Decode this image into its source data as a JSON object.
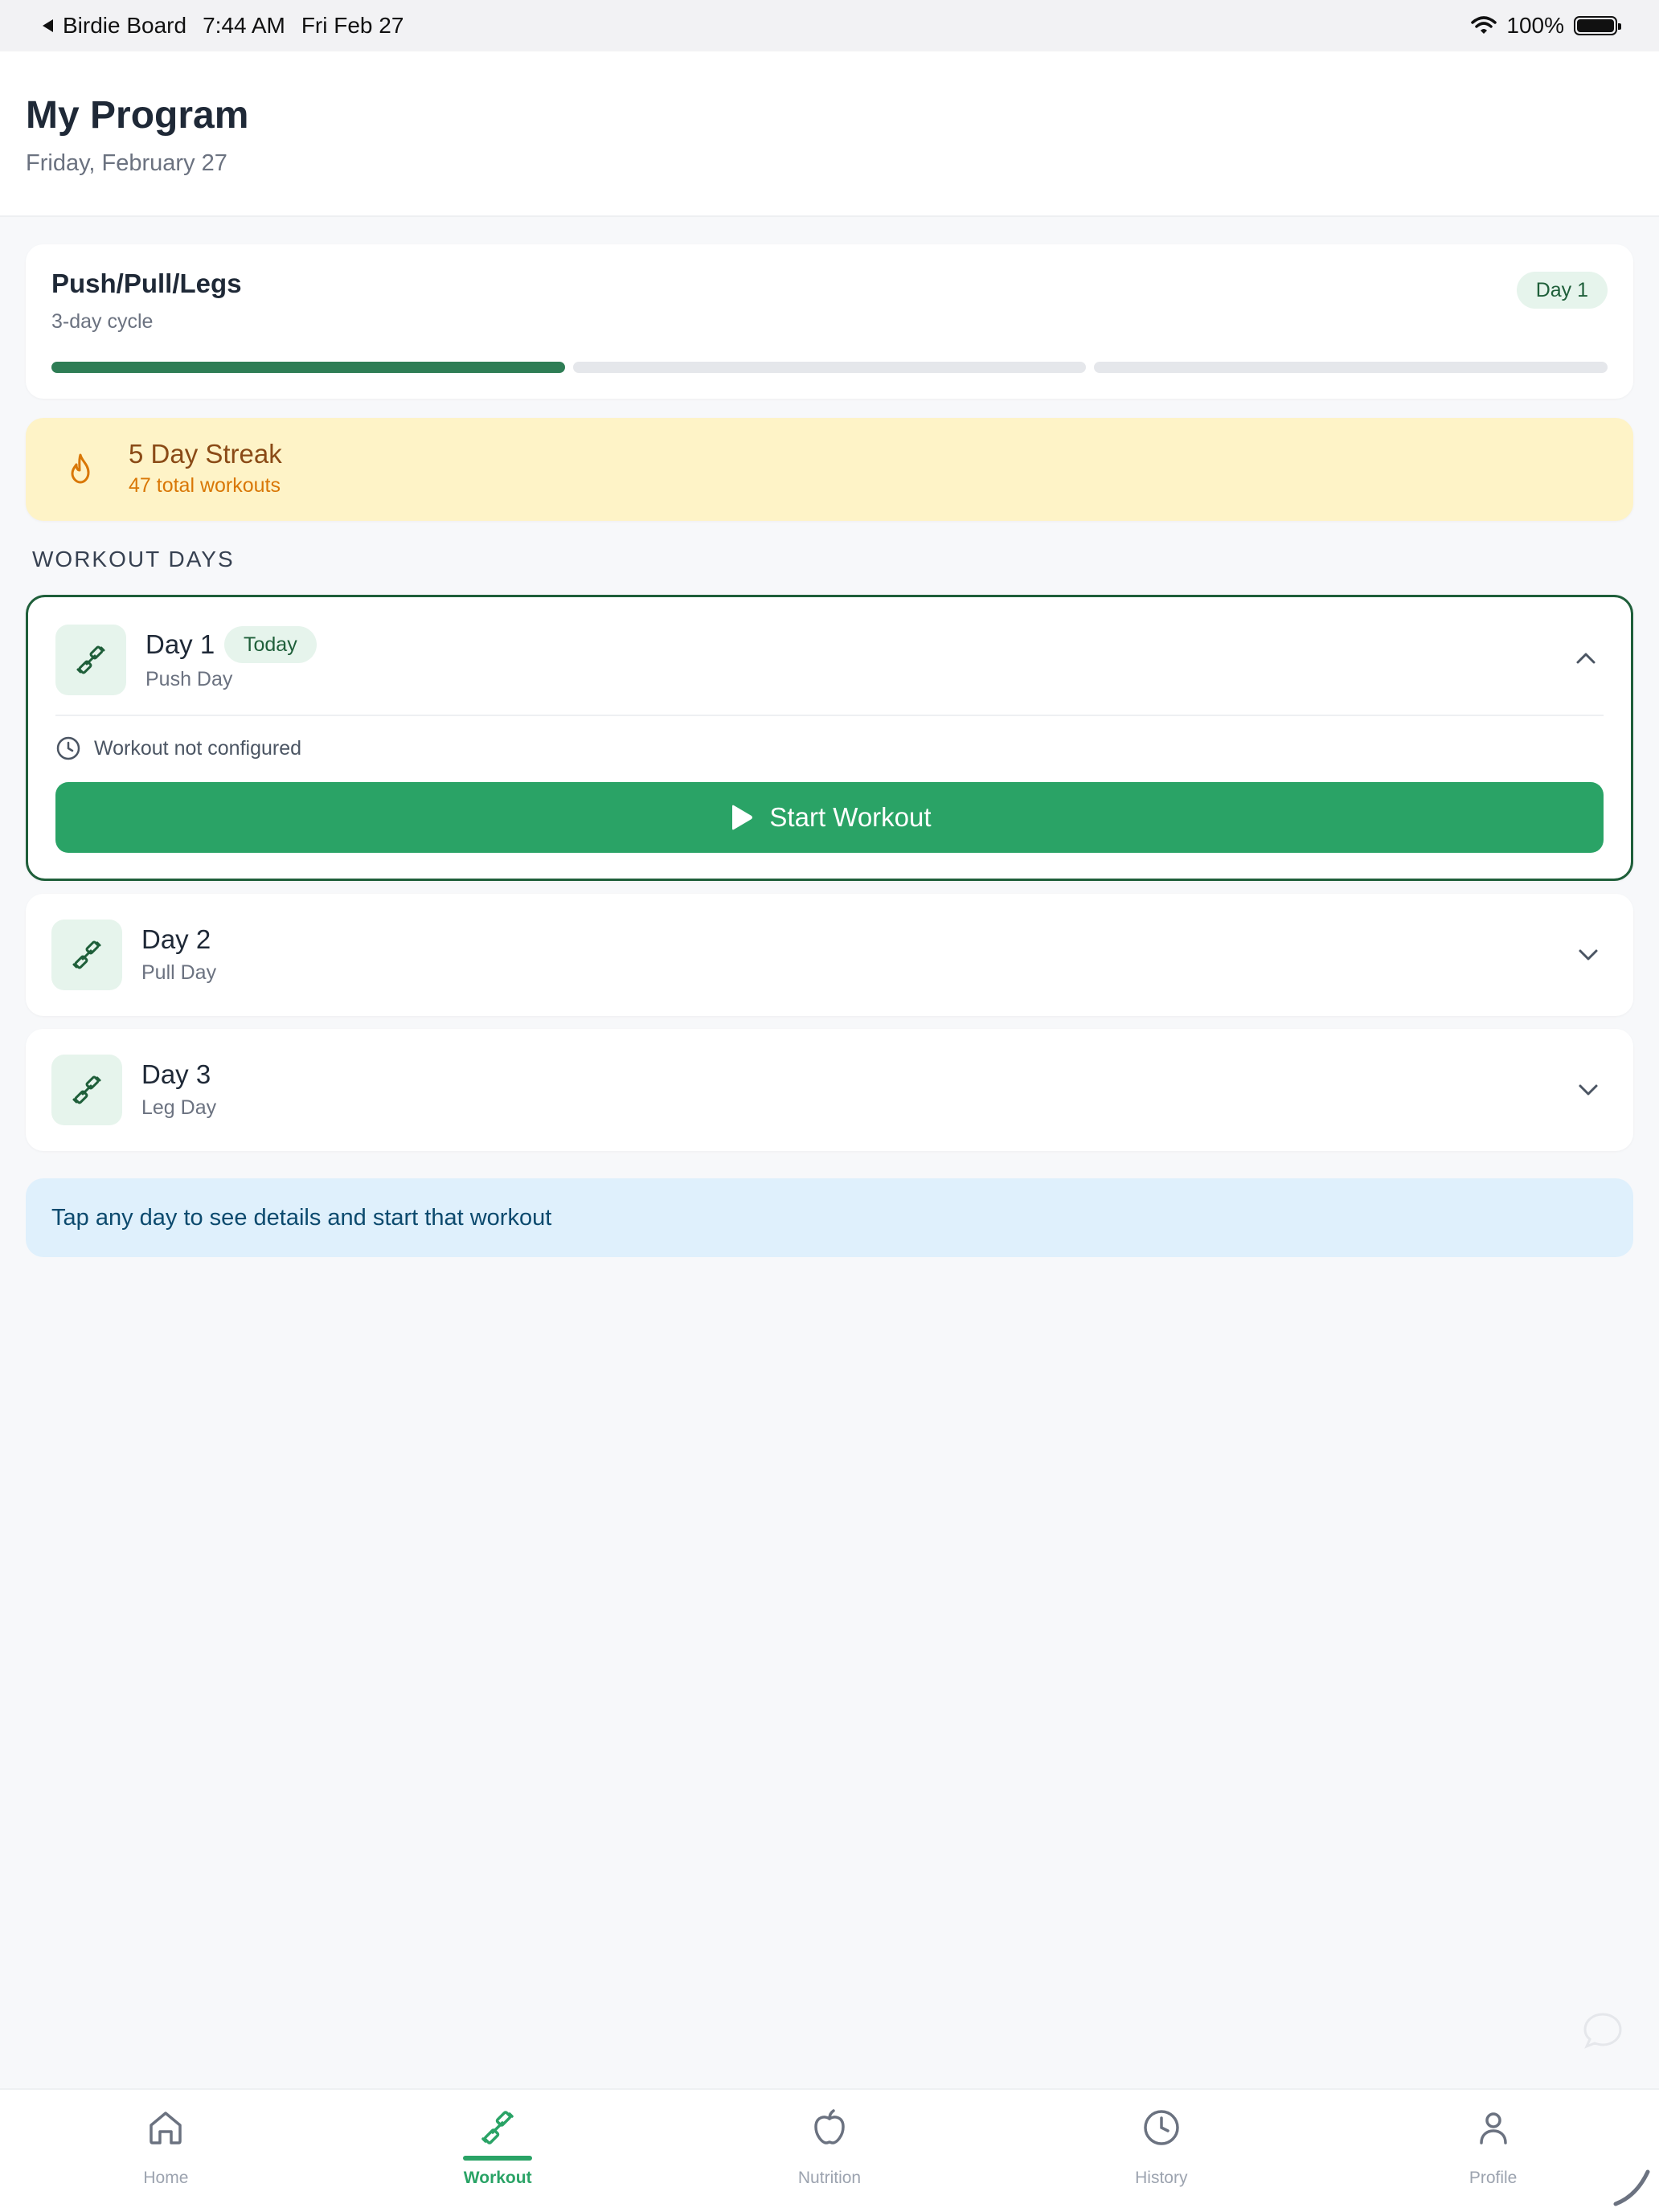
{
  "status_bar": {
    "back_label": "Birdie Board",
    "time": "7:44 AM",
    "date": "Fri Feb 27",
    "battery": "100%"
  },
  "header": {
    "title": "My Program",
    "date": "Friday, February 27"
  },
  "program": {
    "name": "Push/Pull/Legs",
    "cycle": "3-day cycle",
    "current_day_badge": "Day 1",
    "progress_segments": 3,
    "progress_completed": 1
  },
  "streak": {
    "title": "5 Day Streak",
    "subtitle": "47 total workouts",
    "icon": "flame-icon"
  },
  "section_label": "WORKOUT DAYS",
  "days": [
    {
      "title": "Day 1",
      "subtitle": "Push Day",
      "badge": "Today",
      "expanded": true,
      "status": "Workout not configured",
      "button_label": "Start Workout"
    },
    {
      "title": "Day 2",
      "subtitle": "Pull Day",
      "expanded": false
    },
    {
      "title": "Day 3",
      "subtitle": "Leg Day",
      "expanded": false
    }
  ],
  "tip": "Tap any day to see details and start that workout",
  "nav": [
    {
      "label": "Home",
      "icon": "home-icon",
      "active": false
    },
    {
      "label": "Workout",
      "icon": "dumbbell-icon",
      "active": true
    },
    {
      "label": "Nutrition",
      "icon": "apple-icon",
      "active": false
    },
    {
      "label": "History",
      "icon": "clock-icon",
      "active": false
    },
    {
      "label": "Profile",
      "icon": "person-icon",
      "active": false
    }
  ],
  "colors": {
    "accent": "#2aa366",
    "accent_dark": "#1f5f3a",
    "streak_bg": "#fef3c7",
    "tip_bg": "#dff0fc"
  }
}
